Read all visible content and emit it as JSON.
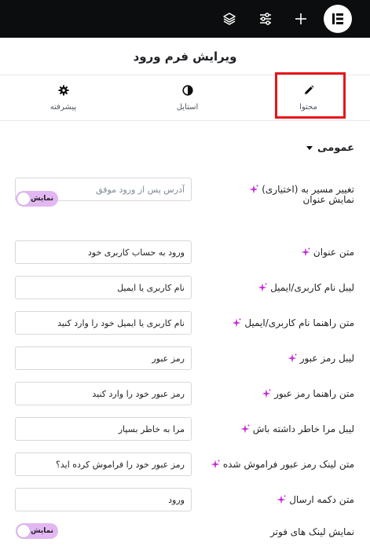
{
  "topbar": {
    "icons": [
      "elementor-logo-icon",
      "add-icon",
      "sliders-icon",
      "layers-icon"
    ]
  },
  "panel": {
    "title": "ویرایش فرم ورود"
  },
  "tabs": [
    {
      "label": "محتوا",
      "icon": "pencil-icon",
      "active": true
    },
    {
      "label": "استایل",
      "icon": "half-circle-icon",
      "active": false
    },
    {
      "label": "پیشرفته",
      "icon": "gear-icon",
      "active": false
    }
  ],
  "section": {
    "title": "عمومی"
  },
  "fields": [
    {
      "label": "تغییر مسیر به (اختیاری)",
      "value": "آدرس پس از ورود موفق",
      "placeholder": true
    },
    {
      "label": "نمایش عنوان",
      "toggle": "نمایش"
    },
    {
      "label": "متن عنوان",
      "value": "ورود به حساب کاربری خود"
    },
    {
      "label": "لیبل نام کاربری/ایمیل",
      "value": "نام کاربری یا ایمیل"
    },
    {
      "label": "متن راهنما نام کاربری/ایمیل",
      "value": "نام کاربری یا ایمیل خود را وارد کنید"
    },
    {
      "label": "لیبل رمز عبور",
      "value": "رمز عبور"
    },
    {
      "label": "متن راهنما رمز عبور",
      "value": "رمز عبور خود را وارد کنید"
    },
    {
      "label": "لیبل مرا خاطر داشته باش",
      "value": "مرا به خاطر بسپار"
    },
    {
      "label": "متن لینک رمز عبور فراموش شده",
      "value": "رمز عبور خود را فراموش کرده اید؟"
    },
    {
      "label": "متن دکمه ارسال",
      "value": "ورود"
    },
    {
      "label": "نمایش لینک های فوتر",
      "toggle": "نمایش"
    }
  ],
  "colors": {
    "topbar": "#0c0d0e",
    "highlight": "#e8141b",
    "ai_sparkle": "#c62bd6",
    "toggle_on": "#e2b7f2"
  }
}
